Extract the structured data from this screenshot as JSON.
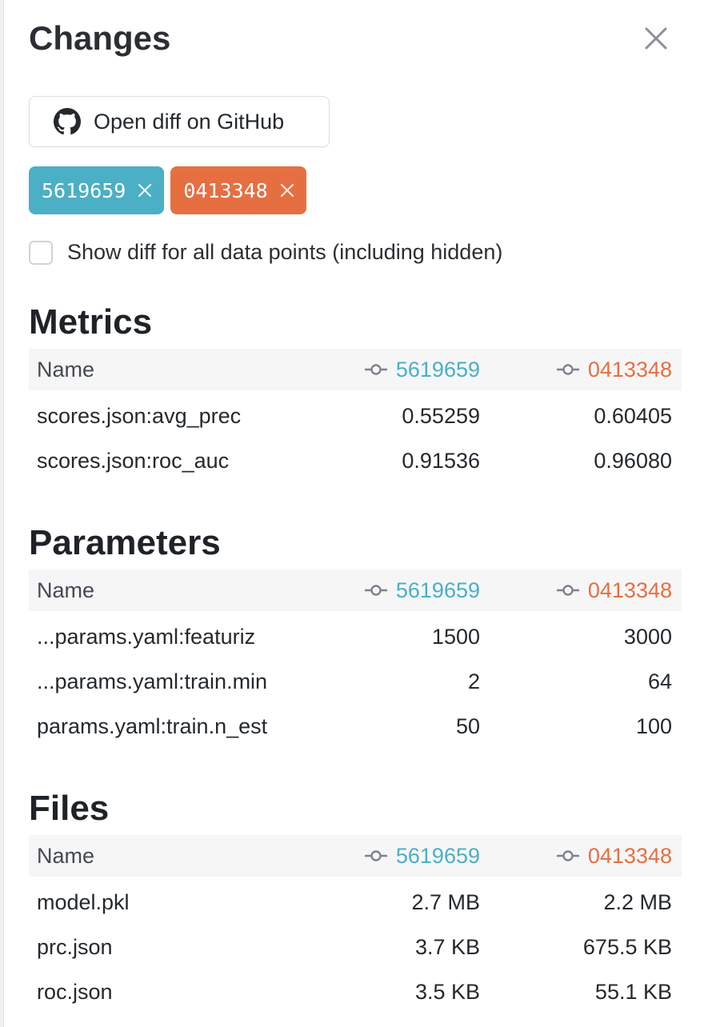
{
  "header": {
    "title": "Changes"
  },
  "github_button": {
    "label": "Open diff on GitHub"
  },
  "chips": [
    {
      "label": "5619659",
      "color": "#4bafc6"
    },
    {
      "label": "0413348",
      "color": "#e66f42"
    }
  ],
  "show_all": {
    "label": "Show diff for all data points (including hidden)",
    "checked": false
  },
  "columns": {
    "name": "Name",
    "a": "5619659",
    "b": "0413348"
  },
  "metrics": {
    "title": "Metrics",
    "rows": [
      {
        "name": "scores.json:avg_prec",
        "a": "0.55259",
        "b": "0.60405"
      },
      {
        "name": "scores.json:roc_auc",
        "a": "0.91536",
        "b": "0.96080"
      }
    ]
  },
  "parameters": {
    "title": "Parameters",
    "rows": [
      {
        "name": "...params.yaml:featuriz",
        "a": "1500",
        "b": "3000"
      },
      {
        "name": "...params.yaml:train.min",
        "a": "2",
        "b": "64"
      },
      {
        "name": "params.yaml:train.n_est",
        "a": "50",
        "b": "100"
      }
    ]
  },
  "files": {
    "title": "Files",
    "rows": [
      {
        "name": "model.pkl",
        "a": "2.7 MB",
        "b": "2.2 MB"
      },
      {
        "name": "prc.json",
        "a": "3.7 KB",
        "b": "675.5 KB"
      },
      {
        "name": "roc.json",
        "a": "3.5 KB",
        "b": "55.1 KB"
      }
    ]
  },
  "icons": {
    "close": "close-icon",
    "github": "github-icon",
    "commit": "commit-icon",
    "chip_remove": "remove-icon"
  }
}
